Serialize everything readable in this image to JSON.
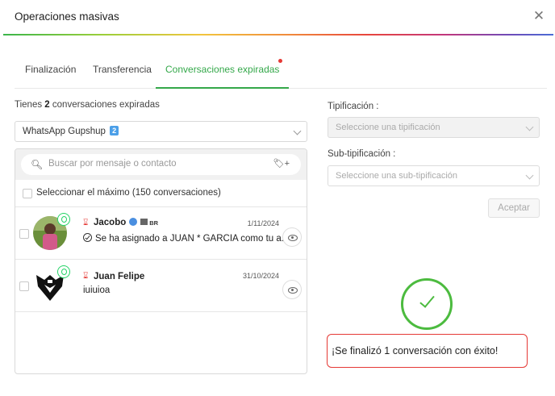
{
  "modal": {
    "title": "Operaciones masivas",
    "close_icon": "close-icon"
  },
  "tabs": [
    {
      "label": "Finalización",
      "active": false
    },
    {
      "label": "Transferencia",
      "active": false
    },
    {
      "label": "Conversaciones expiradas",
      "active": true,
      "notification_dot": true
    }
  ],
  "colors": {
    "accent": "#34a84a",
    "error": "#e53935",
    "success": "#4cbb3f"
  },
  "summary": {
    "prefix": "Tienes ",
    "count": "2",
    "suffix": " conversaciones expiradas"
  },
  "channel_select": {
    "value": "WhatsApp Gupshup",
    "badge": "2"
  },
  "search": {
    "placeholder": "Buscar por mensaje o contacto",
    "tag_icon": "+"
  },
  "select_all": {
    "label": "Seleccionar el máximo (150 conversaciones)"
  },
  "conversations": [
    {
      "name": "Jacobo",
      "date": "1/11/2024",
      "message": "Se ha asignado a JUAN * GARCIA como tu a...",
      "tag": "BR",
      "channel_icon": "whatsapp-icon"
    },
    {
      "name": "Juan Felipe",
      "date": "31/10/2024",
      "message": "iuiuioa",
      "channel_icon": "whatsapp-icon"
    }
  ],
  "tipificacion": {
    "label": "Tipificación :",
    "placeholder": "Seleccione una tipificación"
  },
  "subtipificacion": {
    "label": "Sub-tipificación :",
    "placeholder": "Seleccione una sub-tipificación"
  },
  "accept_button": {
    "label": "Aceptar"
  },
  "success": {
    "message": "¡Se finalizó 1 conversación con éxito!"
  }
}
